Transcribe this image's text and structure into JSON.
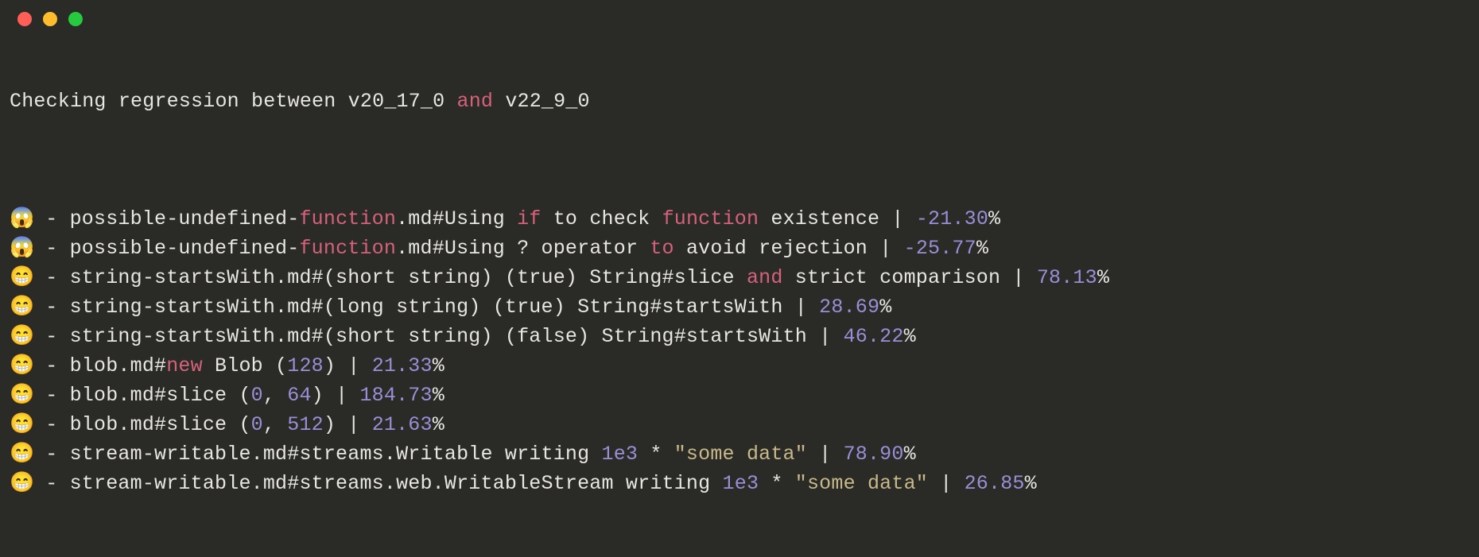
{
  "header": {
    "prefix": "Checking regression between ",
    "v1": "v20_17_0",
    "and": " and ",
    "v2": "v22_9_0"
  },
  "colors": {
    "bg": "#2a2a27",
    "fg": "#e8e6e3",
    "keyword": "#d6627a",
    "number": "#9a8fd6",
    "string": "#c9b98a",
    "red": "#ff5f56",
    "yellow": "#ffbd2e",
    "green": "#27c93f"
  },
  "rows": [
    {
      "emoji": "😱",
      "segments": [
        {
          "t": " - possible-undefined-",
          "c": "fg"
        },
        {
          "t": "function",
          "c": "kw"
        },
        {
          "t": ".md#Using ",
          "c": "fg"
        },
        {
          "t": "if",
          "c": "kw"
        },
        {
          "t": " to check ",
          "c": "fg"
        },
        {
          "t": "function",
          "c": "kw"
        },
        {
          "t": " existence | ",
          "c": "fg"
        },
        {
          "t": "-21.30",
          "c": "num"
        },
        {
          "t": "%",
          "c": "fg"
        }
      ]
    },
    {
      "emoji": "😱",
      "segments": [
        {
          "t": " - possible-undefined-",
          "c": "fg"
        },
        {
          "t": "function",
          "c": "kw"
        },
        {
          "t": ".md#Using ? operator ",
          "c": "fg"
        },
        {
          "t": "to",
          "c": "kw"
        },
        {
          "t": " avoid rejection | ",
          "c": "fg"
        },
        {
          "t": "-25.77",
          "c": "num"
        },
        {
          "t": "%",
          "c": "fg"
        }
      ]
    },
    {
      "emoji": "😁",
      "segments": [
        {
          "t": " - string-startsWith.md#(short string) (true) String#slice ",
          "c": "fg"
        },
        {
          "t": "and",
          "c": "kw"
        },
        {
          "t": " strict comparison | ",
          "c": "fg"
        },
        {
          "t": "78.13",
          "c": "num"
        },
        {
          "t": "%",
          "c": "fg"
        }
      ]
    },
    {
      "emoji": "😁",
      "segments": [
        {
          "t": " - string-startsWith.md#(long string) (true) String#startsWith | ",
          "c": "fg"
        },
        {
          "t": "28.69",
          "c": "num"
        },
        {
          "t": "%",
          "c": "fg"
        }
      ]
    },
    {
      "emoji": "😁",
      "segments": [
        {
          "t": " - string-startsWith.md#(short string) (false) String#startsWith | ",
          "c": "fg"
        },
        {
          "t": "46.22",
          "c": "num"
        },
        {
          "t": "%",
          "c": "fg"
        }
      ]
    },
    {
      "emoji": "😁",
      "segments": [
        {
          "t": " - blob.md#",
          "c": "fg"
        },
        {
          "t": "new",
          "c": "kw"
        },
        {
          "t": " Blob (",
          "c": "fg"
        },
        {
          "t": "128",
          "c": "num"
        },
        {
          "t": ") | ",
          "c": "fg"
        },
        {
          "t": "21.33",
          "c": "num"
        },
        {
          "t": "%",
          "c": "fg"
        }
      ]
    },
    {
      "emoji": "😁",
      "segments": [
        {
          "t": " - blob.md#slice (",
          "c": "fg"
        },
        {
          "t": "0",
          "c": "num"
        },
        {
          "t": ", ",
          "c": "fg"
        },
        {
          "t": "64",
          "c": "num"
        },
        {
          "t": ") | ",
          "c": "fg"
        },
        {
          "t": "184.73",
          "c": "num"
        },
        {
          "t": "%",
          "c": "fg"
        }
      ]
    },
    {
      "emoji": "😁",
      "segments": [
        {
          "t": " - blob.md#slice (",
          "c": "fg"
        },
        {
          "t": "0",
          "c": "num"
        },
        {
          "t": ", ",
          "c": "fg"
        },
        {
          "t": "512",
          "c": "num"
        },
        {
          "t": ") | ",
          "c": "fg"
        },
        {
          "t": "21.63",
          "c": "num"
        },
        {
          "t": "%",
          "c": "fg"
        }
      ]
    },
    {
      "emoji": "😁",
      "segments": [
        {
          "t": " - stream-writable.md#streams.Writable writing ",
          "c": "fg"
        },
        {
          "t": "1e3",
          "c": "num"
        },
        {
          "t": " * ",
          "c": "fg"
        },
        {
          "t": "\"some data\"",
          "c": "str"
        },
        {
          "t": " | ",
          "c": "fg"
        },
        {
          "t": "78.90",
          "c": "num"
        },
        {
          "t": "%",
          "c": "fg"
        }
      ]
    },
    {
      "emoji": "😁",
      "segments": [
        {
          "t": " - stream-writable.md#streams.web.WritableStream writing ",
          "c": "fg"
        },
        {
          "t": "1e3",
          "c": "num"
        },
        {
          "t": " * ",
          "c": "fg"
        },
        {
          "t": "\"some data\"",
          "c": "str"
        },
        {
          "t": " | ",
          "c": "fg"
        },
        {
          "t": "26.85",
          "c": "num"
        },
        {
          "t": "%",
          "c": "fg"
        }
      ]
    }
  ]
}
